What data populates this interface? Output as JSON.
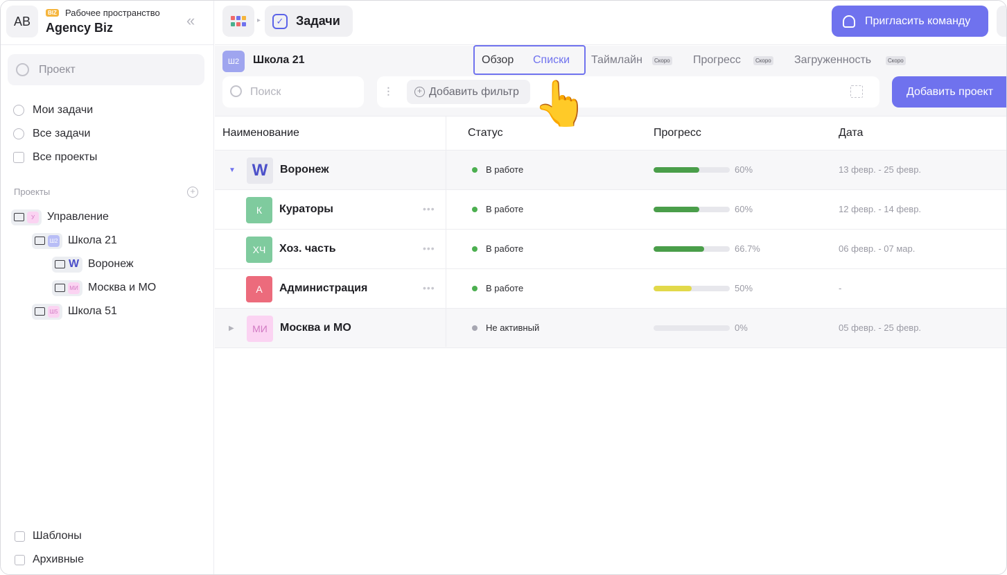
{
  "workspace": {
    "avatar": "AB",
    "badge": "BIZ",
    "label": "Рабочее пространство",
    "name": "Agency Biz"
  },
  "sidebar": {
    "search_placeholder": "Проект",
    "nav": [
      {
        "label": "Мои задачи",
        "icon": "check-circle-icon"
      },
      {
        "label": "Все задачи",
        "icon": "check-circle-icon"
      },
      {
        "label": "Все проекты",
        "icon": "folder-icon"
      }
    ],
    "projects_heading": "Проекты",
    "tree": [
      {
        "label": "Управление",
        "badge": "У",
        "badge_bg": "#fbd3f2",
        "badge_fg": "#d27ac3",
        "level": 0
      },
      {
        "label": "Школа 21",
        "badge": "Ш2",
        "badge_bg": "#b8bdf6",
        "badge_fg": "#ffffff",
        "level": 1
      },
      {
        "label": "Воронеж",
        "badge": "W",
        "badge_bg": "#eceef2",
        "badge_fg": "#4b4fc9",
        "level": 2
      },
      {
        "label": "Москва и МО",
        "badge": "МИ",
        "badge_bg": "#fbd3f2",
        "badge_fg": "#d27ac3",
        "level": 2
      },
      {
        "label": "Школа 51",
        "badge": "Ш5",
        "badge_bg": "#fbd3f2",
        "badge_fg": "#d27ac3",
        "level": 1
      }
    ],
    "footer": [
      {
        "label": "Шаблоны",
        "icon": "templates-icon"
      },
      {
        "label": "Архивные",
        "icon": "archive-icon"
      }
    ]
  },
  "topbar": {
    "breadcrumb": "Задачи",
    "invite_label": "Пригласить команду"
  },
  "project": {
    "badge": "Ш2",
    "title": "Школа 21",
    "tabs": [
      {
        "label": "Обзор",
        "soon": ""
      },
      {
        "label": "Списки",
        "soon": ""
      },
      {
        "label": "Таймлайн",
        "soon": "Скоро"
      },
      {
        "label": "Прогресс",
        "soon": "Скоро"
      },
      {
        "label": "Загруженность",
        "soon": "Скоро"
      }
    ],
    "search_placeholder": "Поиск",
    "add_filter": "Добавить фильтр",
    "add_project": "Добавить проект"
  },
  "table": {
    "headers": [
      "Наименование",
      "Статус",
      "Прогресс",
      "Дата"
    ],
    "rows": [
      {
        "name": "Воронеж",
        "avatar": "W",
        "avatar_bg": "#e8e8ee",
        "avatar_fg": "#4b4fc9",
        "status": "В работе",
        "status_color": "#4caf50",
        "progress": 60,
        "progress_text": "60%",
        "bar_color": "#4a9e4a",
        "date": "13 февр. - 25 февр.",
        "group": true,
        "expanded": true
      },
      {
        "name": "Кураторы",
        "avatar": "К",
        "avatar_bg": "#7fcb9e",
        "avatar_fg": "#ffffff",
        "status": "В работе",
        "status_color": "#4caf50",
        "progress": 60,
        "progress_text": "60%",
        "bar_color": "#4a9e4a",
        "date": "12 февр. - 14 февр.",
        "group": false
      },
      {
        "name": "Хоз. часть",
        "avatar": "ХЧ",
        "avatar_bg": "#7fcb9e",
        "avatar_fg": "#ffffff",
        "status": "В работе",
        "status_color": "#4caf50",
        "progress": 66.7,
        "progress_text": "66.7%",
        "bar_color": "#4a9e4a",
        "date": "06 февр. - 07 мар.",
        "group": false
      },
      {
        "name": "Администрация",
        "avatar": "А",
        "avatar_bg": "#ec6b7c",
        "avatar_fg": "#ffffff",
        "status": "В работе",
        "status_color": "#4caf50",
        "progress": 50,
        "progress_text": "50%",
        "bar_color": "#e2d94a",
        "date": "-",
        "group": false
      },
      {
        "name": "Москва и МО",
        "avatar": "МИ",
        "avatar_bg": "#fbd3f2",
        "avatar_fg": "#d27ac3",
        "status": "Не активный",
        "status_color": "#a7a7b2",
        "progress": 0,
        "progress_text": "0%",
        "bar_color": "#a7a7b2",
        "date": "05 февр. - 25 февр.",
        "group": true,
        "expanded": false
      }
    ]
  },
  "overlay": {
    "pointer": "👆"
  }
}
